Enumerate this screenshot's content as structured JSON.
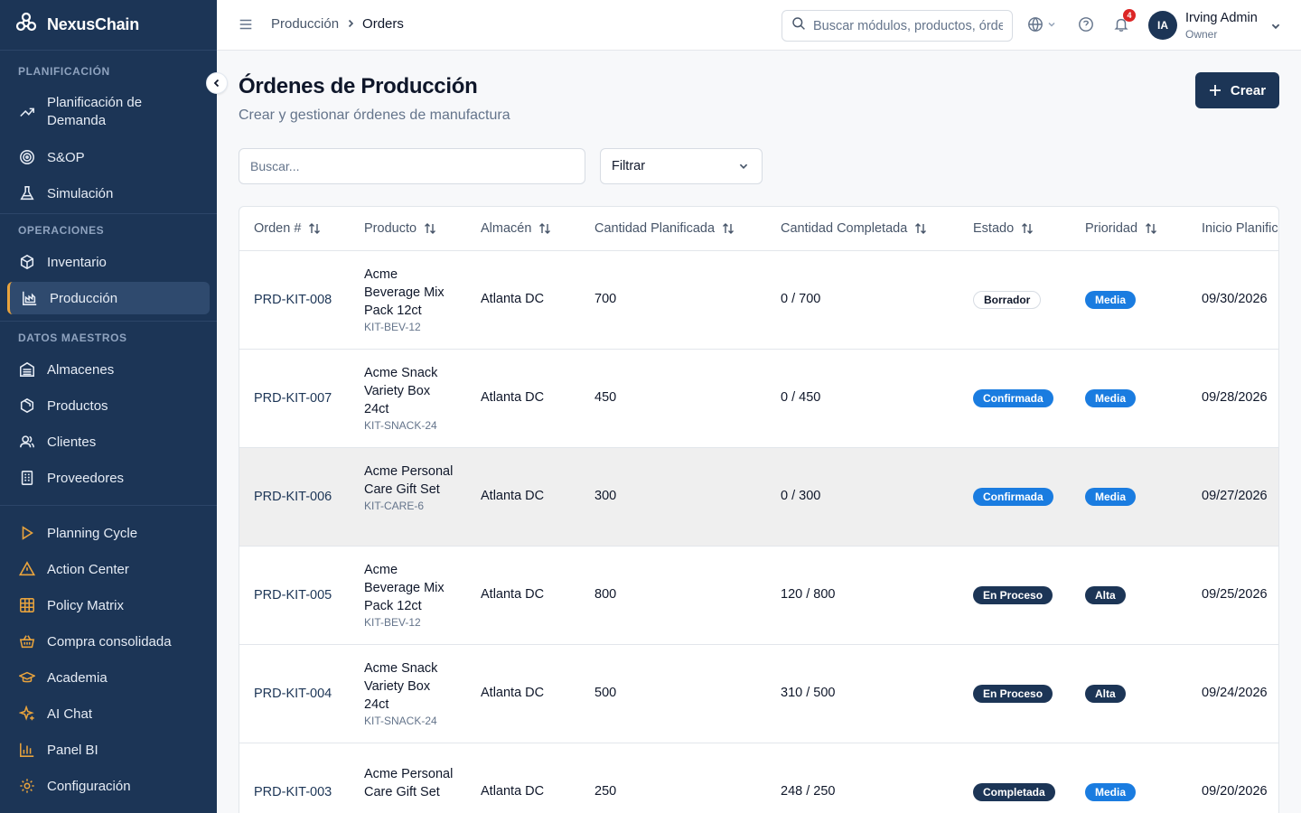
{
  "brand": {
    "name": "NexusChain"
  },
  "sidebar": {
    "sections": {
      "planning": "PLANIFICACIÓN",
      "operations": "OPERACIONES",
      "master": "DATOS MAESTROS"
    },
    "items": {
      "demand": "Planificación de Demanda",
      "sop": "S&OP",
      "simulation": "Simulación",
      "inventory": "Inventario",
      "production": "Producción",
      "warehouses": "Almacenes",
      "products": "Productos",
      "clients": "Clientes",
      "suppliers": "Proveedores",
      "planning_cycle": "Planning Cycle",
      "action_center": "Action Center",
      "policy_matrix": "Policy Matrix",
      "consolidated": "Compra consolidada",
      "academy": "Academia",
      "ai_chat": "AI Chat",
      "bi": "Panel BI",
      "settings": "Configuración"
    }
  },
  "topbar": {
    "breadcrumb": [
      "Producción",
      "Orders"
    ],
    "search_placeholder": "Buscar módulos, productos, órdenes...",
    "notifications": "4",
    "user": {
      "initials": "IA",
      "name": "Irving Admin",
      "role": "Owner"
    }
  },
  "page": {
    "title": "Órdenes de Producción",
    "subtitle": "Crear y gestionar órdenes de manufactura",
    "create_label": "Crear",
    "search_placeholder": "Buscar...",
    "filter_label": "Filtrar"
  },
  "table": {
    "columns": [
      "Orden #",
      "Producto",
      "Almacén",
      "Cantidad Planificada",
      "Cantidad Completada",
      "Estado",
      "Prioridad",
      "Inicio Planificado"
    ],
    "rows": [
      {
        "order": "PRD-KIT-008",
        "product": "Acme Beverage Mix Pack 12ct",
        "sku": "KIT-BEV-12",
        "warehouse": "Atlanta DC",
        "planned": "700",
        "completed": "0 / 700",
        "status": "Borrador",
        "priority": "Media",
        "start": "09/30/2026"
      },
      {
        "order": "PRD-KIT-007",
        "product": "Acme Snack Variety Box 24ct",
        "sku": "KIT-SNACK-24",
        "warehouse": "Atlanta DC",
        "planned": "450",
        "completed": "0 / 450",
        "status": "Confirmada",
        "priority": "Media",
        "start": "09/28/2026"
      },
      {
        "order": "PRD-KIT-006",
        "product": "Acme Personal Care Gift Set",
        "sku": "KIT-CARE-6",
        "warehouse": "Atlanta DC",
        "planned": "300",
        "completed": "0 / 300",
        "status": "Confirmada",
        "priority": "Media",
        "start": "09/27/2026"
      },
      {
        "order": "PRD-KIT-005",
        "product": "Acme Beverage Mix Pack 12ct",
        "sku": "KIT-BEV-12",
        "warehouse": "Atlanta DC",
        "planned": "800",
        "completed": "120 / 800",
        "status": "En Proceso",
        "priority": "Alta",
        "start": "09/25/2026"
      },
      {
        "order": "PRD-KIT-004",
        "product": "Acme Snack Variety Box 24ct",
        "sku": "KIT-SNACK-24",
        "warehouse": "Atlanta DC",
        "planned": "500",
        "completed": "310 / 500",
        "status": "En Proceso",
        "priority": "Alta",
        "start": "09/24/2026"
      },
      {
        "order": "PRD-KIT-003",
        "product": "Acme Personal Care Gift Set",
        "sku": "",
        "warehouse": "Atlanta DC",
        "planned": "250",
        "completed": "248 / 250",
        "status": "Completada",
        "priority": "Media",
        "start": "09/20/2026"
      }
    ]
  },
  "colors": {
    "sidebar": "#1c3556",
    "accent_gold": "#e8a33d",
    "blue": "#1a7ce0",
    "navy": "#1c3556",
    "badge": "#dc2626"
  }
}
